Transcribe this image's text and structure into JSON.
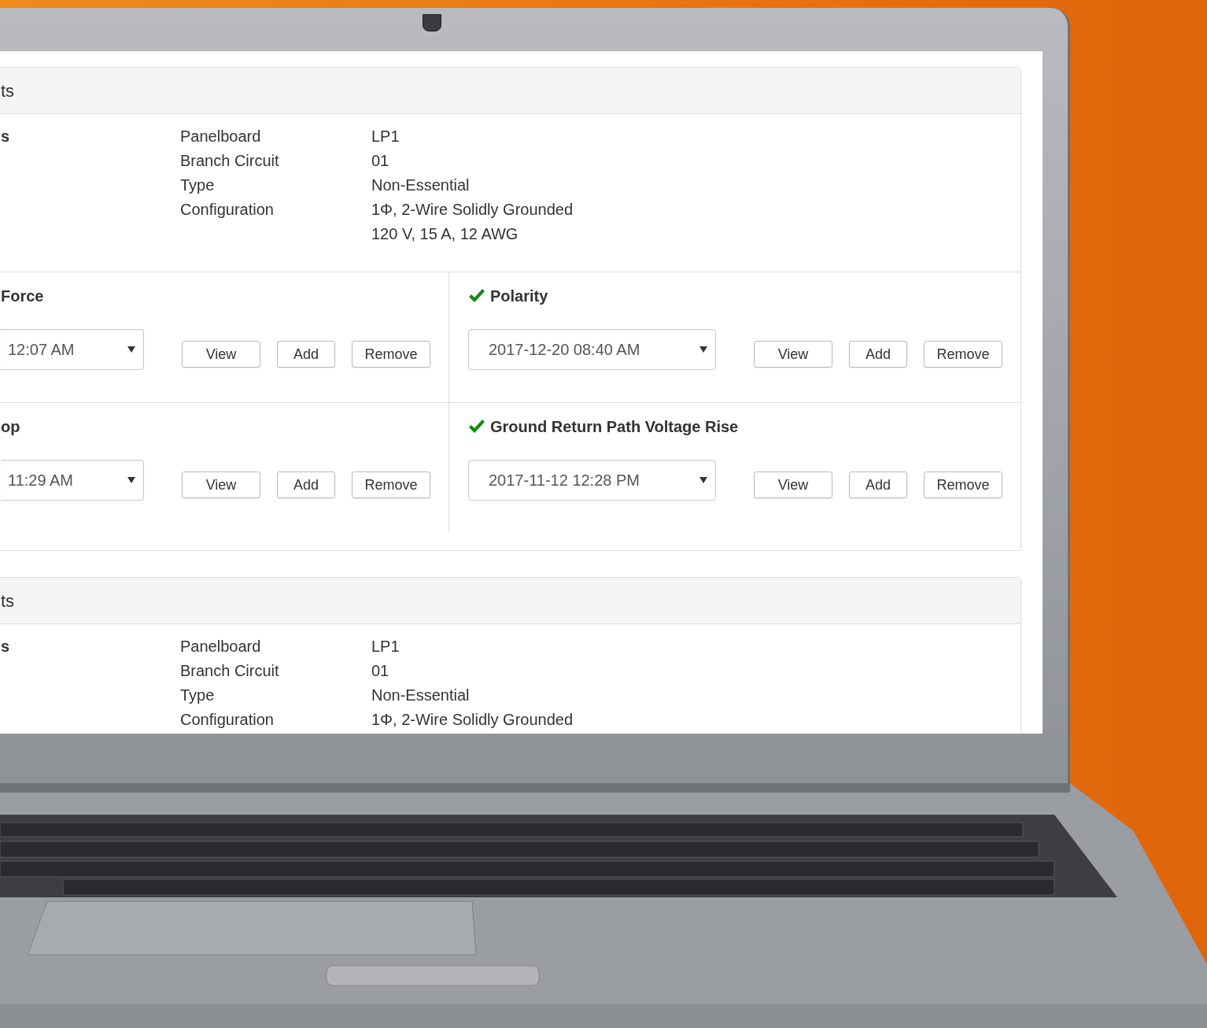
{
  "panels": [
    {
      "heading": "ts",
      "info_label": "s",
      "info": [
        {
          "label": "Panelboard",
          "values": [
            "LP1"
          ]
        },
        {
          "label": "Branch Circuit",
          "values": [
            "01"
          ]
        },
        {
          "label": "Type",
          "values": [
            "Non-Essential"
          ]
        },
        {
          "label": "Configuration",
          "values": [
            "1Φ, 2-Wire Solidly Grounded",
            "120 V, 15 A, 12 AWG"
          ]
        }
      ],
      "tests": [
        {
          "name": "Force",
          "checked": false,
          "reading": "12:07 AM",
          "buttons": [
            "View",
            "Add",
            "Remove"
          ]
        },
        {
          "name": "Polarity",
          "checked": true,
          "reading": "2017-12-20 08:40 AM",
          "buttons": [
            "View",
            "Add",
            "Remove"
          ]
        },
        {
          "name": "op",
          "checked": false,
          "reading": "11:29 AM",
          "buttons": [
            "View",
            "Add",
            "Remove"
          ]
        },
        {
          "name": "Ground Return Path Voltage Rise",
          "checked": true,
          "reading": "2017-11-12 12:28 PM",
          "buttons": [
            "View",
            "Add",
            "Remove"
          ]
        }
      ]
    },
    {
      "heading": "ts",
      "info_label": "s",
      "info": [
        {
          "label": "Panelboard",
          "values": [
            "LP1"
          ]
        },
        {
          "label": "Branch Circuit",
          "values": [
            "01"
          ]
        },
        {
          "label": "Type",
          "values": [
            "Non-Essential"
          ]
        },
        {
          "label": "Configuration",
          "values": [
            "1Φ, 2-Wire Solidly Grounded"
          ]
        }
      ]
    }
  ]
}
